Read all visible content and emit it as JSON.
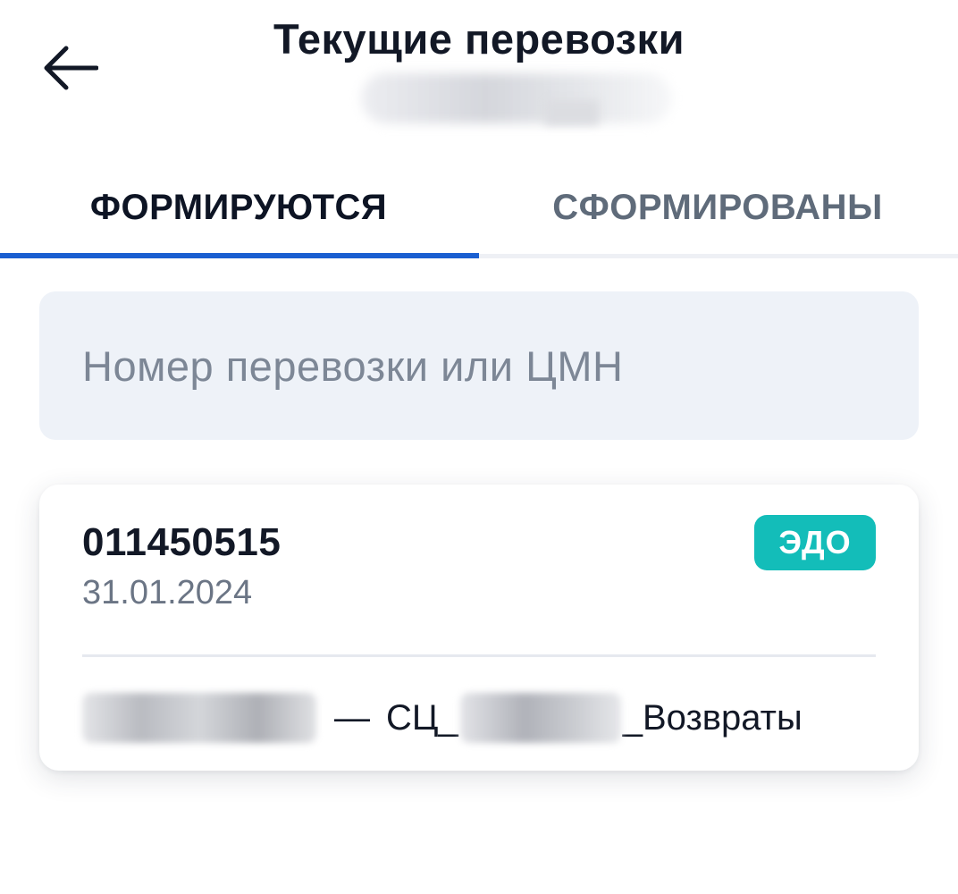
{
  "header": {
    "title": "Текущие перевозки",
    "back_icon": "arrow-left-icon"
  },
  "tabs": [
    {
      "label": "ФОРМИРУЮТСЯ",
      "active": true
    },
    {
      "label": "СФОРМИРОВАНЫ",
      "active": false
    }
  ],
  "colors": {
    "accent": "#1a5fd1",
    "badge": "#13bdb9"
  },
  "search": {
    "placeholder": "Номер перевозки или ЦМН",
    "value": ""
  },
  "shipments": [
    {
      "number": "011450515",
      "date": "31.01.2024",
      "badge": "ЭДО",
      "route": {
        "dash": "—",
        "prefix": "СЦ_",
        "suffix": "_Возвраты"
      }
    }
  ]
}
